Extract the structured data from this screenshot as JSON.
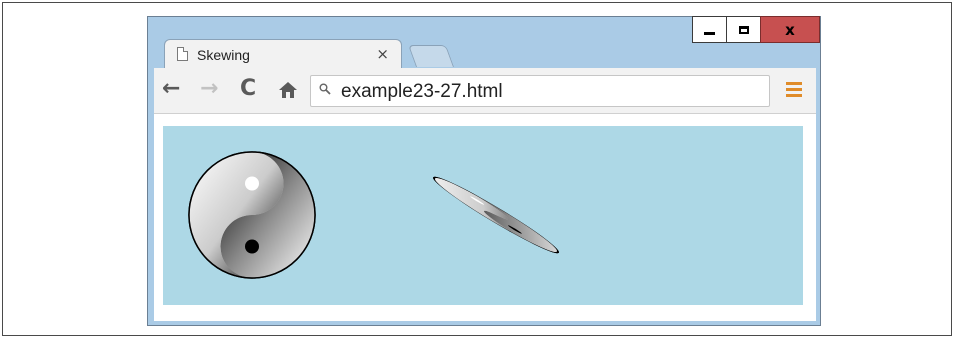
{
  "browser": {
    "tab_title": "Skewing",
    "tab_close": "×",
    "address": "example23-27.html"
  },
  "window_controls": {
    "close_label": "x"
  },
  "icons": {
    "back": "back-arrow-icon",
    "forward": "forward-arrow-icon",
    "reload": "reload-icon",
    "home": "home-icon",
    "search": "search-icon",
    "menu": "menu-icon"
  },
  "colors": {
    "canvas_background": "#add8e6",
    "close_button": "#c75050",
    "menu_accent": "#e08c2a"
  }
}
